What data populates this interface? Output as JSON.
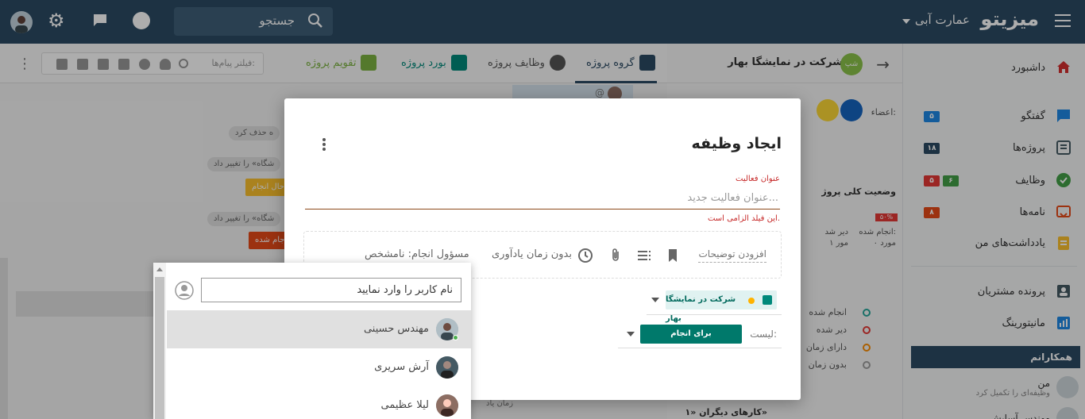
{
  "topbar": {
    "brand": "میزیتو",
    "org": "عمارت آبی",
    "search_placeholder": "جستجو"
  },
  "sidebar": {
    "items": [
      {
        "label": "داشبورد",
        "icon": "home-icon"
      },
      {
        "label": "گفتگو",
        "icon": "chat-icon",
        "badge": "۵"
      },
      {
        "label": "پروژه‌ها",
        "icon": "projects-icon",
        "badge": "۱۸"
      },
      {
        "label": "وظایف",
        "icon": "tasks-icon",
        "badge": "۵",
        "badge2": "۶"
      },
      {
        "label": "نامه‌ها",
        "icon": "mail-icon",
        "badge": "۸"
      },
      {
        "label": "یادداشت‌های من",
        "icon": "notes-icon"
      },
      {
        "label": "پرونده مشتریان",
        "icon": "customers-icon"
      },
      {
        "label": "مانیتورینگ",
        "icon": "monitoring-icon"
      }
    ],
    "team_header": "همکارانم",
    "members": [
      {
        "name": "من",
        "sub": "وظیفه‌ای را تکمیل کرد"
      },
      {
        "name": "مهندس آسایش",
        "sub": ""
      }
    ]
  },
  "project_panel": {
    "title": "شرکت در نمایشگا بهار",
    "logo": "شپ",
    "members_label": "اعضاء:",
    "status_title": "وضعیت کلی پروژ",
    "progress": "۵۰%",
    "done_label": "انجام شده:",
    "done_value": "۰ مورد",
    "late_label": "دیر شد",
    "late_value": "۱ مور",
    "legend": [
      "انجام شده",
      "دیر شده",
      "دارای زمان",
      "بدون زمان"
    ],
    "others": "کارهای دیگران «۱»"
  },
  "main": {
    "tabs": [
      {
        "label": "گروه پروژه",
        "active": true
      },
      {
        "label": "وظایف پروژه"
      },
      {
        "label": "بورد پروژه"
      },
      {
        "label": "تقویم پروژه"
      }
    ],
    "filter_placeholder": "فیلتر پیام‌ها:",
    "feed": [
      {
        "text": "ه حذف کرد"
      },
      {
        "text": "شگاه» را تغییر داد"
      },
      {
        "text": "حال انجام"
      },
      {
        "text": "شگاه» را تغییر داد"
      },
      {
        "text": "جام شده"
      }
    ],
    "mention": "@",
    "reminder_fragment": "زمان یاد"
  },
  "modal": {
    "title": "ایجاد وظیفه",
    "field_label": "عنوان فعالیت",
    "field_placeholder": "عنوان فعالیت جدید...",
    "error": "این فیلد الزامی است.",
    "add_description": "افزودن توضیحات",
    "no_reminder": "بدون زمان یادآوری",
    "responsible": "مسؤول انجام: نامشخص",
    "project_chip": "شرکت در نمایشگا بهار",
    "list_label": "لیست:",
    "list_value": "برای انجام"
  },
  "user_dropdown": {
    "placeholder": "نام کاربر را وارد نمایید",
    "users": [
      {
        "name": "مهندس حسینی",
        "online": true,
        "selected": true
      },
      {
        "name": "آرش سریری",
        "online": false
      },
      {
        "name": "لیلا عظیمی",
        "online": false
      }
    ]
  }
}
